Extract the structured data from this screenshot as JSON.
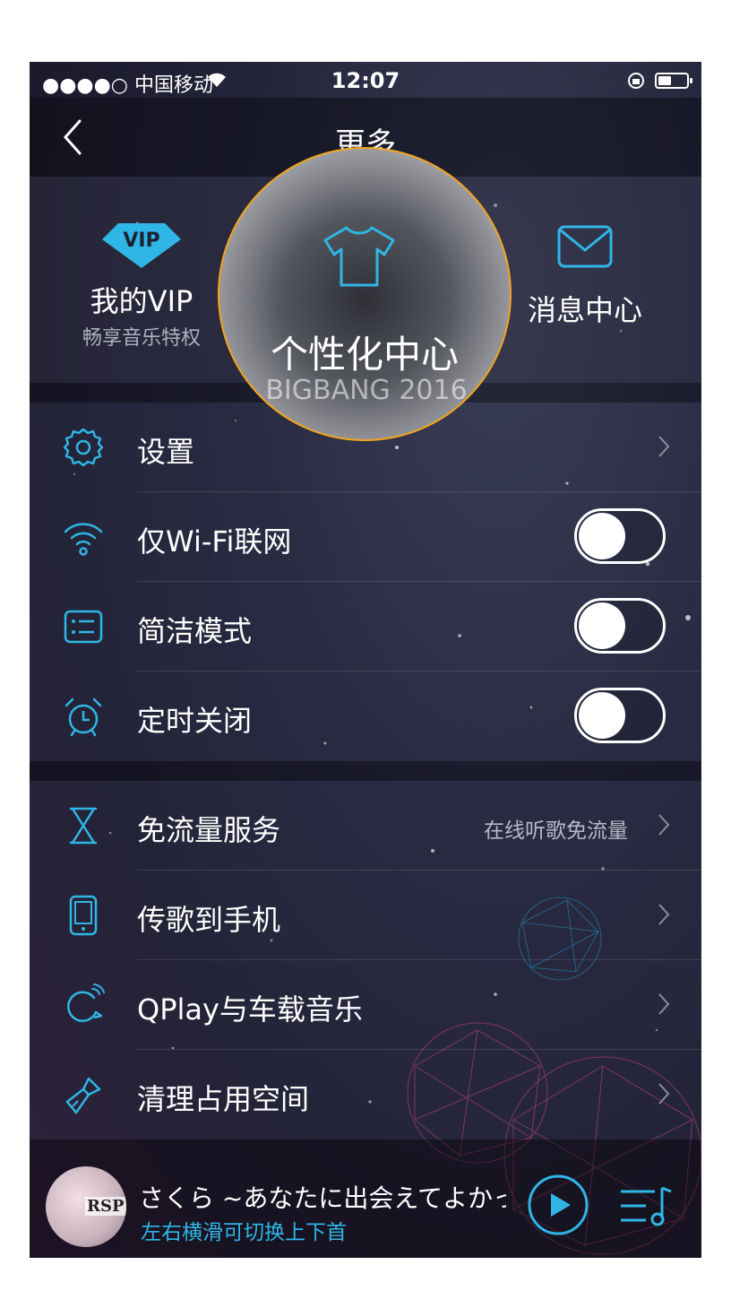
{
  "status_bar": {
    "carrier": "●●●●○ 中国移动",
    "time": "12:07"
  },
  "nav": {
    "title": "更多"
  },
  "top_items": {
    "vip": {
      "badge": "VIP",
      "label": "我的VIP",
      "sub": "畅享音乐特权"
    },
    "personal": {
      "label": "个性化中心",
      "sub": "BIGBANG 2016"
    },
    "messages": {
      "label": "消息中心"
    }
  },
  "section1": [
    {
      "label": "设置",
      "icon": "gear-icon",
      "control": "chevron"
    },
    {
      "label": "仅Wi-Fi联网",
      "icon": "wifi-icon",
      "control": "toggle",
      "on": false
    },
    {
      "label": "简洁模式",
      "icon": "list-icon",
      "control": "toggle",
      "on": false
    },
    {
      "label": "定时关闭",
      "icon": "alarm-clock-icon",
      "control": "toggle",
      "on": false
    }
  ],
  "section2": [
    {
      "label": "免流量服务",
      "hint": "在线听歌免流量",
      "icon": "hourglass-icon"
    },
    {
      "label": "传歌到手机",
      "icon": "phone-icon"
    },
    {
      "label": "QPlay与车载音乐",
      "icon": "qplay-icon"
    },
    {
      "label": "清理占用空间",
      "icon": "brush-icon"
    }
  ],
  "player": {
    "cover_text": "RSP",
    "song": "さくら ~あなたに出会えてよかった~",
    "tip": "左右横滑可切换上下首"
  },
  "colors": {
    "accent": "#2fb6e6",
    "highlight_ring": "#f2a51e"
  }
}
